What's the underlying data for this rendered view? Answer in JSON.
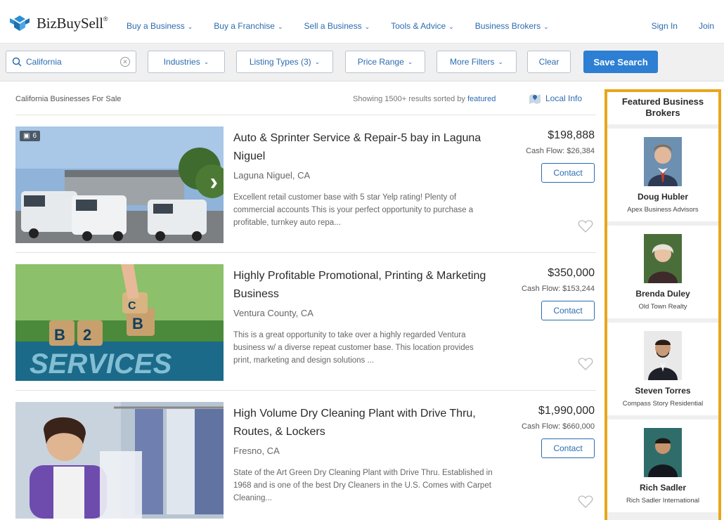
{
  "header": {
    "brand": "BizBuySell",
    "brand_mark": "®",
    "nav": [
      {
        "label": "Buy a Business"
      },
      {
        "label": "Buy a Franchise"
      },
      {
        "label": "Sell a Business"
      },
      {
        "label": "Tools & Advice"
      },
      {
        "label": "Business Brokers"
      }
    ],
    "sign_in": "Sign In",
    "join": "Join"
  },
  "filters": {
    "search_value": "California",
    "industries": "Industries",
    "listing_types": "Listing Types (3)",
    "price_range": "Price Range",
    "more_filters": "More Filters",
    "clear": "Clear",
    "save_search": "Save Search"
  },
  "results": {
    "title": "California Businesses For Sale",
    "sorted_prefix": "Showing 1500+ results sorted by",
    "sorted_by": "featured",
    "local_info": "Local Info"
  },
  "listings": [
    {
      "title": "Auto & Sprinter Service & Repair-5 bay in Laguna Niguel",
      "location": "Laguna Niguel, CA",
      "description": "Excellent retail customer base with 5 star Yelp rating! Plenty of commercial accounts This is your perfect opportunity to purchase a profitable, turnkey auto repa...",
      "price": "$198,888",
      "cash_flow": "Cash Flow: $26,384",
      "contact": "Contact",
      "photo_count": "6"
    },
    {
      "title": "Highly Profitable Promotional, Printing & Marketing Business",
      "location": "Ventura County, CA",
      "description": "This is a great opportunity to take over a highly regarded Ventura business w/ a diverse repeat customer base. This location provides print, marketing and design solutions ...",
      "price": "$350,000",
      "cash_flow": "Cash Flow: $153,244",
      "contact": "Contact"
    },
    {
      "title": "High Volume Dry Cleaning Plant with Drive Thru, Routes, & Lockers",
      "location": "Fresno, CA",
      "description": "State of the Art Green Dry Cleaning Plant with Drive Thru. Established in 1968 and is one of the best Dry Cleaners in the U.S. Comes with Carpet Cleaning...",
      "price": "$1,990,000",
      "cash_flow": "Cash Flow: $660,000",
      "contact": "Contact"
    }
  ],
  "sidebar": {
    "title": "Featured Business Brokers",
    "brokers": [
      {
        "name": "Doug Hubler",
        "org": "Apex Business Advisors"
      },
      {
        "name": "Brenda Duley",
        "org": "Old Town Realty"
      },
      {
        "name": "Steven Torres",
        "org": "Compass Story Residential"
      },
      {
        "name": "Rich Sadler",
        "org": "Rich Sadler International"
      }
    ]
  },
  "colors": {
    "link_blue": "#2b6cb0",
    "save_blue": "#2d7fd3",
    "sidebar_border": "#e8a61b"
  }
}
